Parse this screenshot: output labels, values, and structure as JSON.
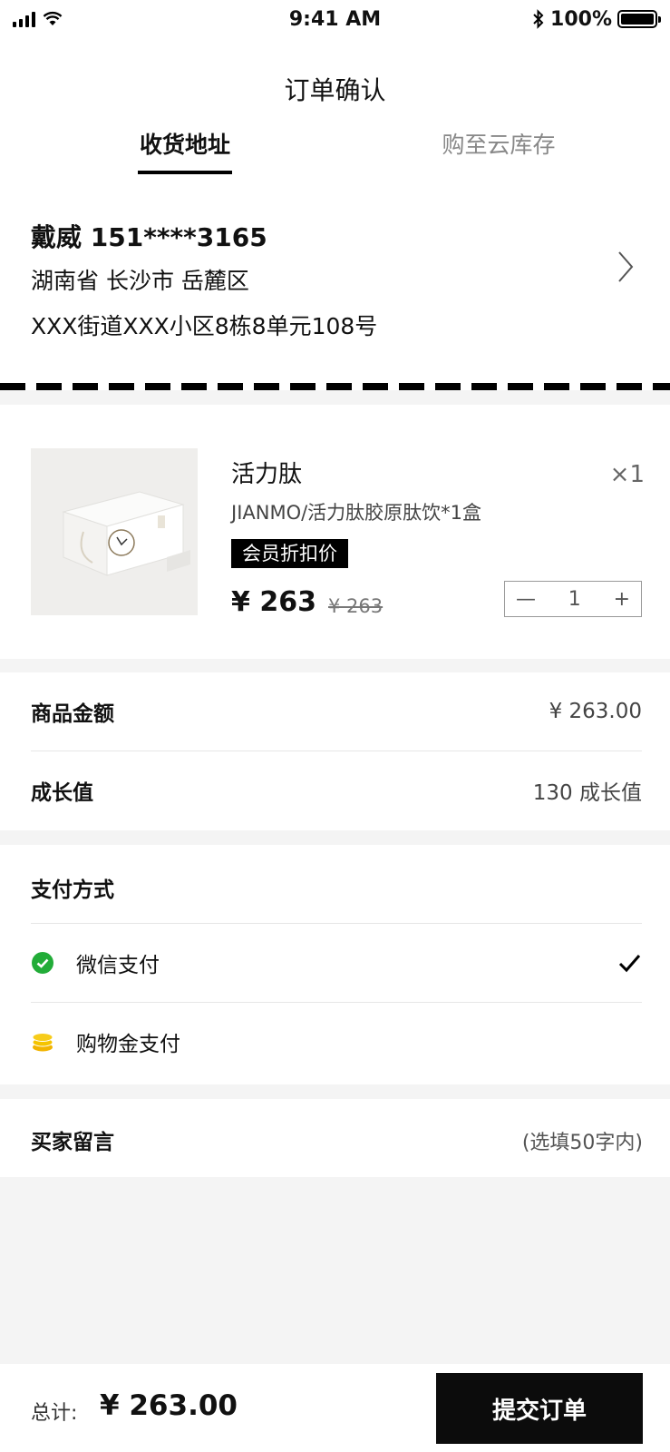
{
  "status_bar": {
    "time": "9:41 AM",
    "battery": "100%",
    "battery_level": 1.0
  },
  "header": {
    "title": "订单确认",
    "tabs": [
      {
        "label": "收货地址",
        "active": true
      },
      {
        "label": "购至云库存",
        "active": false
      }
    ]
  },
  "address": {
    "name_phone": "戴威  151****3165",
    "region": "湖南省  长沙市  岳麓区",
    "street": "XXX街道XXX小区8栋8单元108号",
    "arrow_icon": "chevron-right-icon"
  },
  "product": {
    "name": "活力肽",
    "quantity_mark": "×1",
    "description": "JIANMO/活力肽胶原肽饮*1盒",
    "badge": "会员折扣价",
    "price": "¥ 263",
    "original_price": "¥ 263",
    "quantity": "1",
    "minus": "—",
    "plus": "+"
  },
  "amounts": {
    "goods_label": "商品金额",
    "goods_value": "¥ 263.00",
    "growth_label": "成长值",
    "growth_value": "130 成长值"
  },
  "payment": {
    "title": "支付方式",
    "methods": [
      {
        "label": "微信支付",
        "icon": "wechat-icon",
        "selected": true,
        "color": "#22ac38"
      },
      {
        "label": "购物金支付",
        "icon": "coins-icon",
        "selected": false,
        "color": "#f2b400"
      }
    ]
  },
  "message": {
    "label": "买家留言",
    "hint": "(选填50字内)"
  },
  "footer": {
    "total_label": "总计:",
    "total_value": "¥ 263.00",
    "submit_label": "提交订单"
  }
}
